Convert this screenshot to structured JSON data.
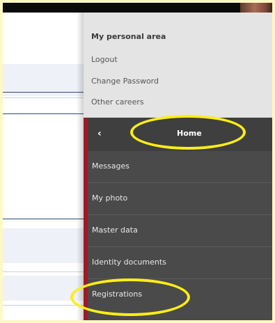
{
  "personal_area": {
    "title": "My personal area",
    "links": [
      {
        "label": "Logout"
      },
      {
        "label": "Change Password"
      },
      {
        "label": "Other careers"
      }
    ]
  },
  "nav": {
    "back_icon": "chevron-left-icon",
    "back_glyph": "‹",
    "home_label": "Home",
    "items": [
      {
        "label": "Messages"
      },
      {
        "label": "My photo"
      },
      {
        "label": "Master data"
      },
      {
        "label": "Identity documents"
      },
      {
        "label": "Registrations"
      }
    ]
  },
  "colors": {
    "highlight_ring": "#fbee16",
    "accent_red": "#a11826",
    "menu_dark": "#4a4a4a",
    "personal_bg": "#e4e4e4",
    "frame_bg": "#fdf8c4"
  }
}
